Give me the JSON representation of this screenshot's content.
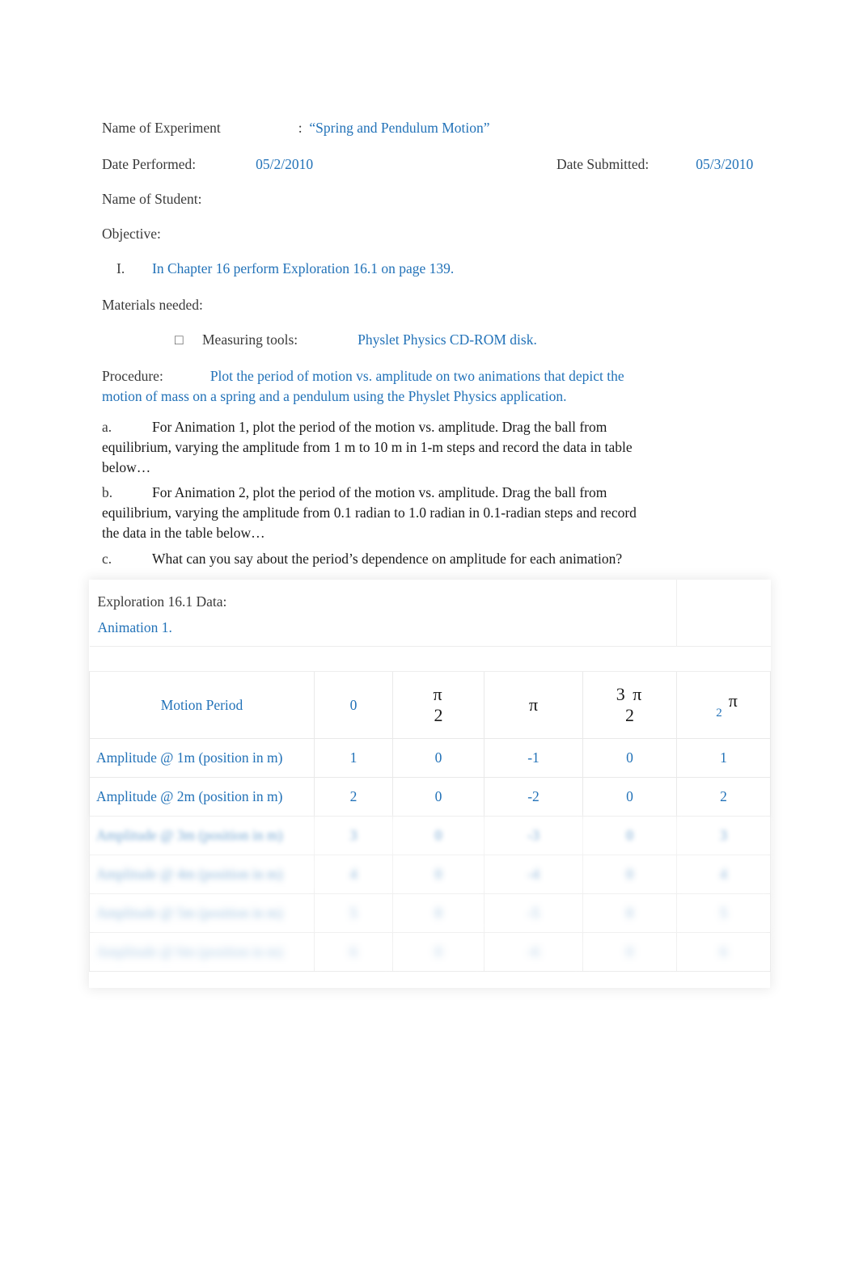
{
  "document": {
    "header": {
      "experiment_label": "Name of Experiment",
      "experiment_colon": ":",
      "experiment_value": "“Spring and Pendulum Motion”",
      "date_performed_label": "Date Performed:",
      "date_performed_value": "05/2/2010",
      "date_submitted_label": "Date Submitted:",
      "date_submitted_value": "05/3/2010",
      "student_label": "Name of Student:"
    },
    "objective": {
      "heading": "Objective:",
      "item_number": "I.",
      "item_text": "In Chapter 16 perform Exploration 16.1 on page 139."
    },
    "materials": {
      "heading": "Materials needed:",
      "bullet_glyph": "□",
      "tool_label": "Measuring tools:",
      "tool_value": "Physlet Physics CD-ROM disk."
    },
    "procedure": {
      "label": "Procedure:",
      "text": "Plot the period of motion vs. amplitude on two animations that depict the motion of mass on a spring and a pendulum using the Physlet Physics application.",
      "steps": [
        {
          "marker": "a.",
          "text": "For Animation 1, plot the period of the motion vs. amplitude. Drag the ball from equilibrium, varying the amplitude from 1 m to 10 m in 1-m steps and record the data in table below…"
        },
        {
          "marker": "b.",
          "text": "For Animation 2, plot the period of the motion vs. amplitude. Drag the ball from equilibrium, varying the amplitude from 0.1 radian to 1.0 radian in 0.1-radian steps and record the data in the table below…"
        },
        {
          "marker": "c.",
          "text": "What can you say about the period’s dependence on amplitude for each animation?"
        }
      ]
    },
    "data_table": {
      "caption_line1": "Exploration 16.1 Data:",
      "caption_line2": "Animation 1.",
      "columns": [
        {
          "label": "Motion Period",
          "kind": "label"
        },
        {
          "label": "0",
          "kind": "number"
        },
        {
          "numerator": "π",
          "denominator": "2",
          "kind": "fraction"
        },
        {
          "label": "π",
          "kind": "pi"
        },
        {
          "numerator": "3 π",
          "denominator": "2",
          "kind": "fraction"
        },
        {
          "coefficient": "2",
          "symbol": "π",
          "kind": "coef-pi"
        }
      ],
      "rows": [
        {
          "header": "Amplitude @ 1m (position in m)",
          "values": [
            "1",
            "0",
            "-1",
            "0",
            "1"
          ],
          "blur": "none"
        },
        {
          "header": "Amplitude @ 2m (position in m)",
          "values": [
            "2",
            "0",
            "-2",
            "0",
            "2"
          ],
          "blur": "none"
        },
        {
          "header": "Amplitude @ 3m (position in m)",
          "values": [
            "3",
            "0",
            "-3",
            "0",
            "3"
          ],
          "blur": "b1"
        },
        {
          "header": "Amplitude @ 4m (position in m)",
          "values": [
            "4",
            "0",
            "-4",
            "0",
            "4"
          ],
          "blur": "b2"
        },
        {
          "header": "Amplitude @ 5m (position in m)",
          "values": [
            "5",
            "0",
            "-5",
            "0",
            "5"
          ],
          "blur": "b3"
        },
        {
          "header": "Amplitude @ 6m (position in m)",
          "values": [
            "6",
            "0",
            "-6",
            "0",
            "6"
          ],
          "blur": "b4"
        }
      ]
    },
    "colors": {
      "accent_blue": "#2272b8",
      "body_text": "#3a3a3a",
      "table_border": "#e9e9e9"
    }
  }
}
